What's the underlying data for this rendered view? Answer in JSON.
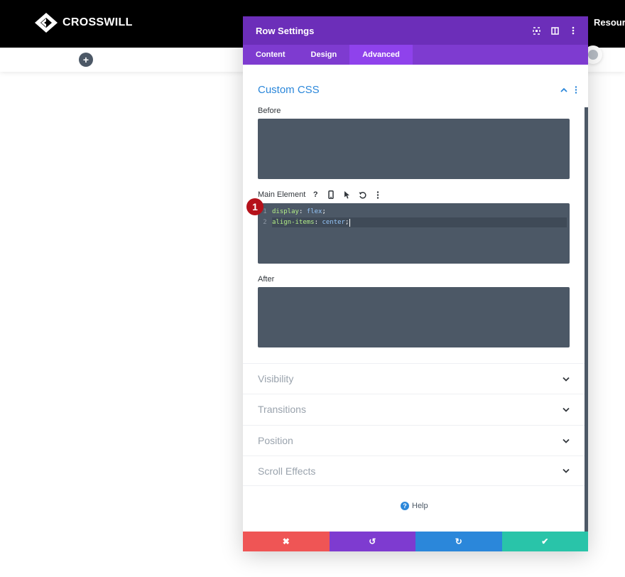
{
  "site": {
    "logo_text": "CROSSWILL",
    "nav_item": "Resourc"
  },
  "builder": {
    "add_symbol": "+"
  },
  "modal": {
    "title": "Row Settings",
    "header_icons": [
      "expand-icon",
      "split-view-icon",
      "more-icon"
    ],
    "tabs": [
      {
        "label": "Content",
        "active": false
      },
      {
        "label": "Design",
        "active": false
      },
      {
        "label": "Advanced",
        "active": true
      }
    ],
    "section": {
      "title": "Custom CSS",
      "fields": [
        {
          "label": "Before",
          "code": []
        },
        {
          "label": "Main Element",
          "code": [
            {
              "num": "1",
              "prop": "display",
              "value": "flex"
            },
            {
              "num": "2",
              "prop": "align-items",
              "value": "center"
            }
          ]
        },
        {
          "label": "After",
          "code": []
        }
      ],
      "tools": [
        "?",
        "mobile-icon",
        "hover-icon",
        "reset-icon",
        "more-icon"
      ]
    },
    "annotation_badge": "1",
    "collapsed_sections": [
      "Visibility",
      "Transitions",
      "Position",
      "Scroll Effects"
    ],
    "help_label": "Help",
    "footer_buttons": [
      {
        "name": "cancel",
        "symbol": "✖",
        "color": "#ef5555"
      },
      {
        "name": "undo",
        "symbol": "↺",
        "color": "#7e3bd0"
      },
      {
        "name": "redo",
        "symbol": "↻",
        "color": "#2b87da"
      },
      {
        "name": "save",
        "symbol": "✔",
        "color": "#29c4a9"
      }
    ]
  },
  "colors": {
    "header_purple": "#6c2eb9",
    "tab_purple": "#7e3bd0",
    "active_tab": "#8f42ec",
    "code_bg": "#4c5866",
    "accent_blue": "#2b87da"
  }
}
